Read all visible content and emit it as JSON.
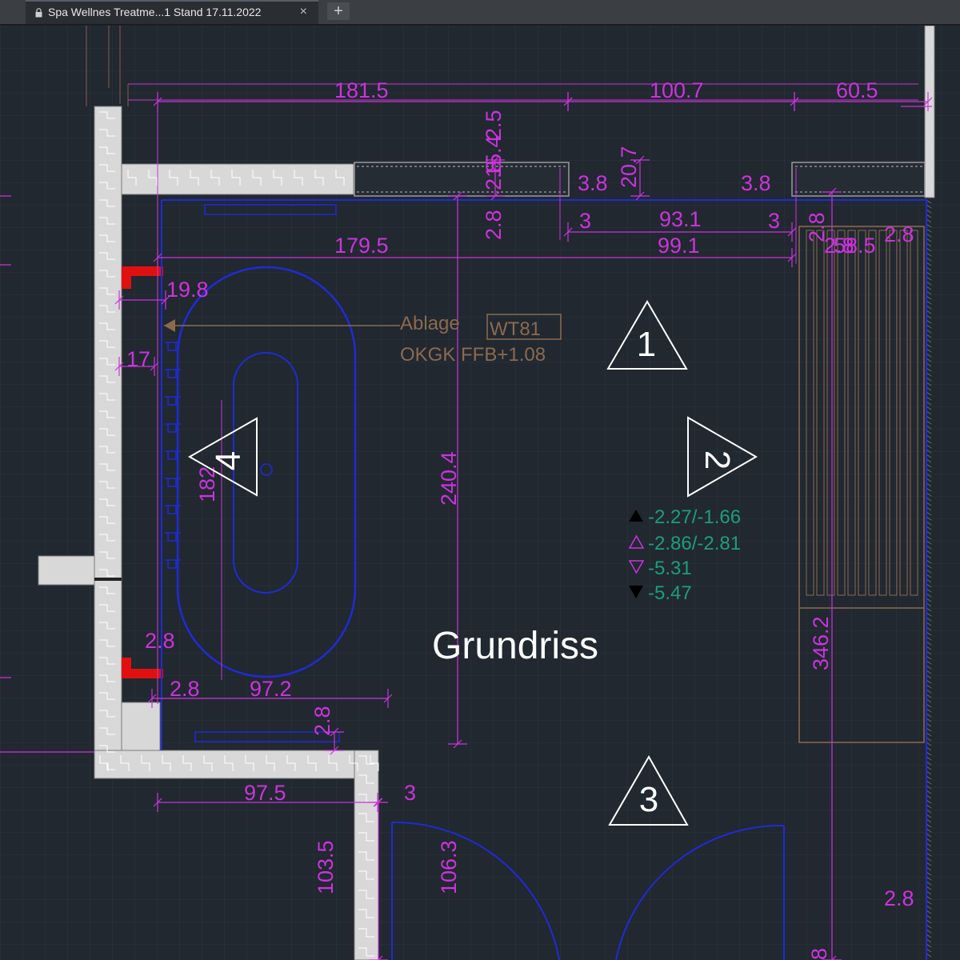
{
  "tab": {
    "title": "Spa Wellnes Treatme...1 Stand 17.11.2022",
    "close_glyph": "×",
    "new_tab_glyph": "+",
    "lock_icon": "lock-icon"
  },
  "colors": {
    "background": "#212830",
    "grid": "#2c3440",
    "dimension": "#cc33dd",
    "wall": "#d8d8d8",
    "fixture": "#1f2bd6",
    "annotation": "#8c6a4e",
    "level": "#1d9e7a",
    "white": "#ffffff",
    "red": "#e01010"
  },
  "drawing": {
    "title": "Grundriss",
    "tag_lines": [
      "Ablage",
      "OKGK FFB+1.08"
    ],
    "tag_code": "WT81",
    "view_markers": [
      "1",
      "2",
      "3",
      "4"
    ],
    "levels": [
      {
        "symbol": "filled-up",
        "text": "-2.27/-1.66"
      },
      {
        "symbol": "outline-up",
        "text": "-2.86/-2.81"
      },
      {
        "symbol": "outline-down",
        "text": "-5.31"
      },
      {
        "symbol": "filled-down",
        "text": "-5.47"
      }
    ],
    "dimensions": [
      "181.5",
      "100.7",
      "60.5",
      "2.5",
      "2.8",
      "15.4",
      "3.8",
      "20.7",
      "3.8",
      "2.8",
      "3",
      "93.1",
      "3",
      "2.8",
      "99.1",
      "2.8",
      "179.5",
      "58.5",
      "2.8",
      "19.8",
      "17",
      "182",
      "240.4",
      "346.2",
      "2.8",
      "2.8",
      "97.2",
      "2.8",
      "97.5",
      "3",
      "103.5",
      "106.3",
      "2.8",
      "8"
    ]
  }
}
